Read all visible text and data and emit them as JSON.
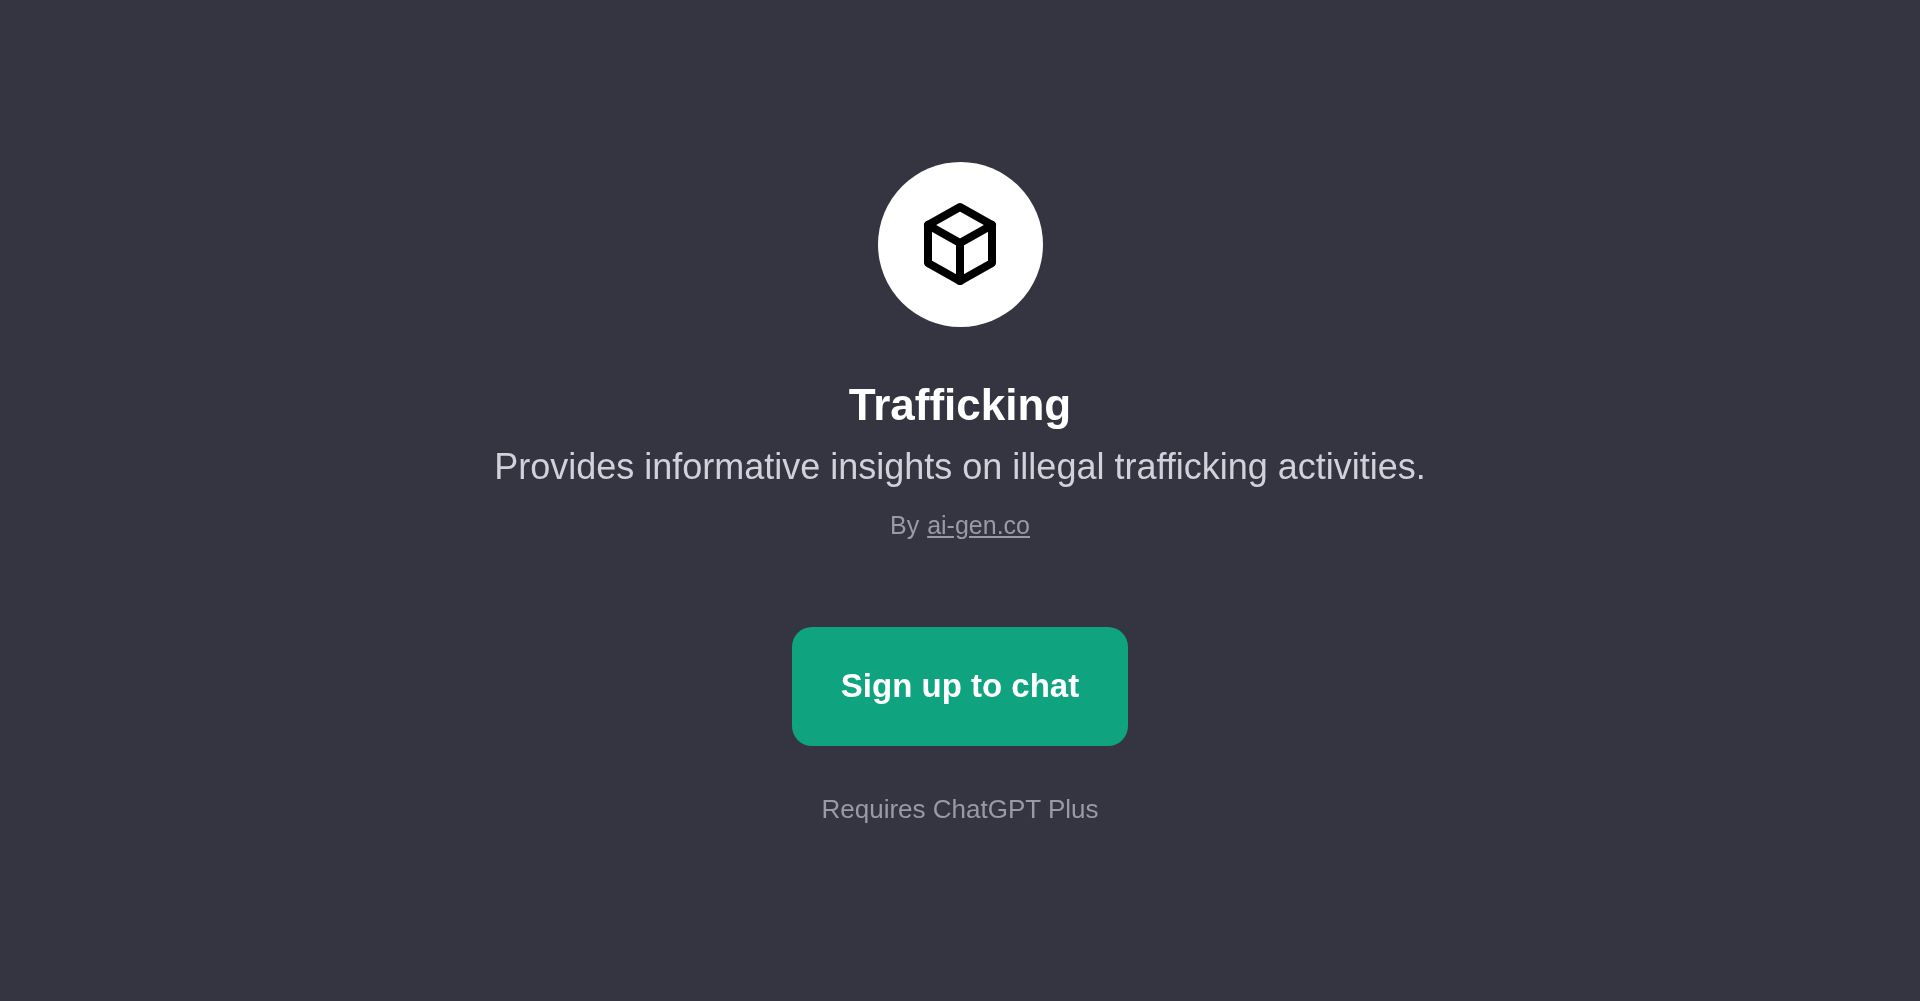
{
  "title": "Trafficking",
  "description": "Provides informative insights on illegal trafficking activities.",
  "author": {
    "prefix": "By",
    "link": "ai-gen.co"
  },
  "button": "Sign up to chat",
  "note": "Requires ChatGPT Plus"
}
